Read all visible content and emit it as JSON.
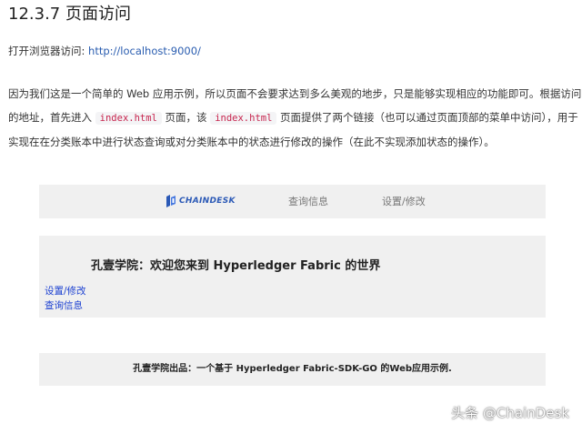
{
  "heading": "12.3.7 页面访问",
  "para1": {
    "prefix": "打开浏览器访问: ",
    "link": "http://localhost:9000/"
  },
  "para2": {
    "line1": "因为我们这是一个简单的 Web 应用示例，所以页面不会要求达到多么美观的地步，只是能够实现相应的功能即可。根据访问",
    "line2_a": "的地址，首先进入 ",
    "line2_code1": "index.html",
    "line2_b": " 页面，该 ",
    "line2_code2": "index.html",
    "line2_c": " 页面提供了两个链接（也可以通过页面顶部的菜单中访问），用于",
    "line3": "实现在在分类账本中进行状态查询或对分类账本中的状态进行修改的操作（在此不实现添加状态的操作）。"
  },
  "demo": {
    "logo_text": "CHAINDESK",
    "nav_query": "查询信息",
    "nav_settings": "设置/修改",
    "welcome": "孔壹学院：欢迎您来到 Hyperledger Fabric 的世界",
    "link_settings": "设置/修改",
    "link_query": "查询信息",
    "footer": "孔壹学院出品：一个基于 Hyperledger Fabric-SDK-GO 的Web应用示例."
  },
  "watermark": "头条 @ChainDesk",
  "colors": {
    "link": "#2a5db0",
    "code_text": "#c7254e",
    "code_bg": "#f4f4f6",
    "panel_bg": "#f0f0f0",
    "logo_blue": "#2b59b6",
    "demo_link": "#1a3fd1"
  }
}
